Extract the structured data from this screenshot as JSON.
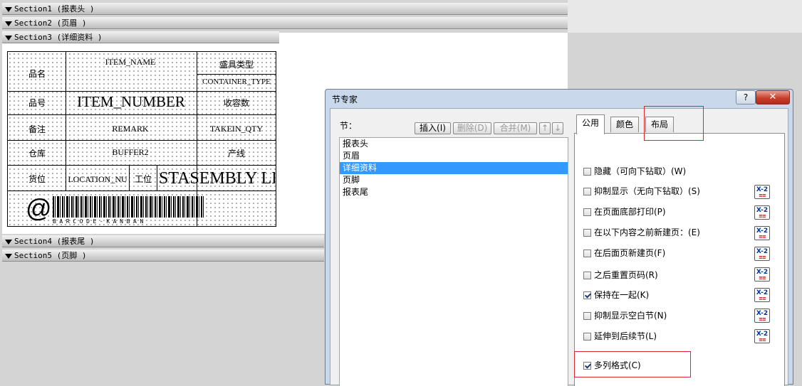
{
  "designer": {
    "sections": [
      "Section1 (报表头  )",
      "Section2 (页眉  )",
      "Section3 (详细资料  )",
      "Section4 (报表尾  )",
      "Section5 (页脚  )"
    ],
    "labels": {
      "pinming": "品名",
      "pinhao": "品号",
      "beizhu": "备注",
      "cangku": "仓库",
      "huowei": "货位",
      "gongwei": "工位",
      "chengju": "盛具类型",
      "shourong": "收容数",
      "chanxian": "产线"
    },
    "fields": {
      "item_name": "ITEM_NAME",
      "container_type": "CONTAINER_TYPE",
      "item_number": "ITEM_NUMBER",
      "remark": "REMARK",
      "takein_qty": "TAKEIN_QTY",
      "buffer2": "BUFFER2",
      "location": "LOCATION_NU",
      "assembly": "STASEMBLY LI"
    },
    "barcode": {
      "symbol": "@",
      "text": "BARCODE-KANBAN"
    }
  },
  "dialog": {
    "title": "节专家",
    "help_label": "?",
    "close_label": "✕",
    "section_label": "节：",
    "buttons": {
      "insert": "插入(I)",
      "delete": "删除(D)",
      "merge": "合并(M)",
      "up": "↑",
      "down": "↓"
    },
    "sections_list": [
      "报表头",
      "页眉",
      "详细资料",
      "页脚",
      "报表尾"
    ],
    "selected_section": "详细资料",
    "tabs": [
      "公用",
      "颜色",
      "布局"
    ],
    "active_tab": "公用",
    "options": [
      {
        "label": "隐藏（可向下钻取）(W)",
        "checked": false,
        "formula": false
      },
      {
        "label": "抑制显示（无向下钻取）(S)",
        "checked": false,
        "formula": true
      },
      {
        "label": "在页面底部打印(P)",
        "checked": false,
        "formula": true
      },
      {
        "label": "在以下内容之前新建页：(E)",
        "checked": false,
        "formula": true
      },
      {
        "label": "在后面页新建页(F)",
        "checked": false,
        "formula": true
      },
      {
        "label": "之后重置页码(R)",
        "checked": false,
        "formula": true
      },
      {
        "label": "保持在一起(K)",
        "checked": true,
        "formula": true
      },
      {
        "label": "抑制显示空白节(N)",
        "checked": false,
        "formula": true
      },
      {
        "label": "延伸到后续节(L)",
        "checked": false,
        "formula": true
      },
      {
        "label": "多列格式(C)",
        "checked": true,
        "formula": false
      }
    ],
    "formula_icon": {
      "line1": "X-2",
      "line2": "≡≡"
    },
    "highlight_color": "#e0252f",
    "selection_color": "#3399ff"
  }
}
